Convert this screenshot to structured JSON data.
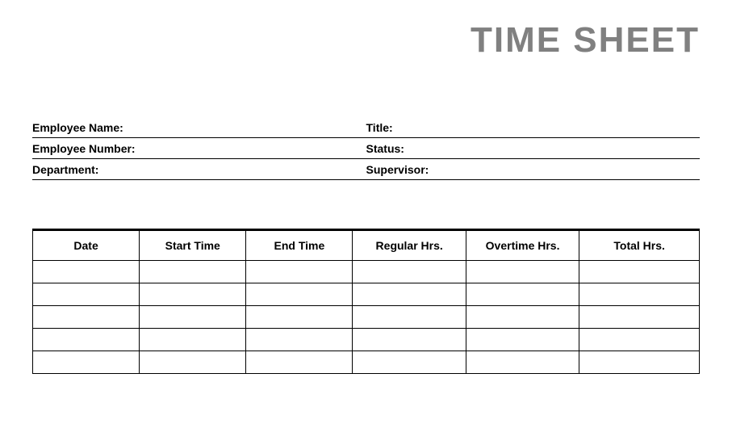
{
  "title": "TIME SHEET",
  "info": {
    "row1": {
      "left": "Employee Name:",
      "right": "Title:"
    },
    "row2": {
      "left": "Employee Number:",
      "right": "Status:"
    },
    "row3": {
      "left": "Department:",
      "right": "Supervisor:"
    }
  },
  "table": {
    "headers": [
      "Date",
      "Start Time",
      "End Time",
      "Regular Hrs.",
      "Overtime Hrs.",
      "Total Hrs."
    ],
    "rows": [
      [
        "",
        "",
        "",
        "",
        "",
        ""
      ],
      [
        "",
        "",
        "",
        "",
        "",
        ""
      ],
      [
        "",
        "",
        "",
        "",
        "",
        ""
      ],
      [
        "",
        "",
        "",
        "",
        "",
        ""
      ],
      [
        "",
        "",
        "",
        "",
        "",
        ""
      ]
    ]
  }
}
